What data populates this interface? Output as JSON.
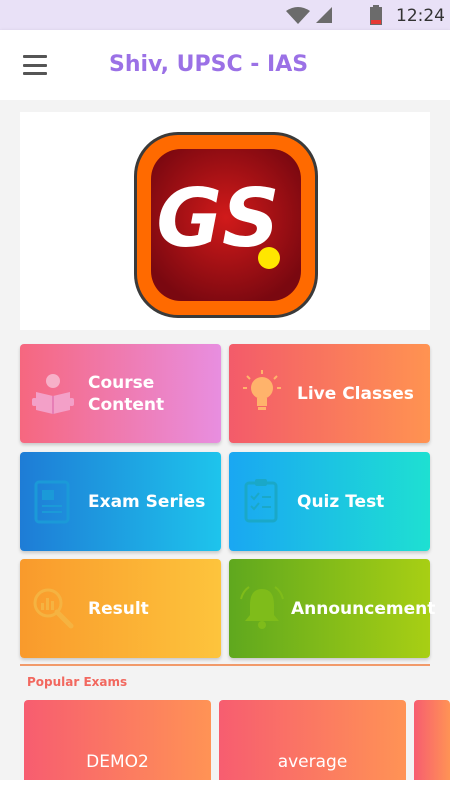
{
  "status_bar": {
    "time": "12:24",
    "icons": [
      "wifi-icon",
      "signal-icon",
      "battery-icon"
    ]
  },
  "app_bar": {
    "title": "Shiv, UPSC - IAS",
    "menu_icon": "hamburger-menu-icon"
  },
  "banner": {
    "logo_text": "GS"
  },
  "tiles": [
    {
      "label": "Course\nContent",
      "icon": "reading-student-icon"
    },
    {
      "label": "Live Classes",
      "icon": "lightbulb-icon"
    },
    {
      "label": "Exam Series",
      "icon": "exam-sheet-icon"
    },
    {
      "label": "Quiz Test",
      "icon": "clipboard-checklist-icon"
    },
    {
      "label": "Result",
      "icon": "magnifier-chart-icon"
    },
    {
      "label": "Announcement",
      "icon": "bell-icon"
    }
  ],
  "popular_exams": {
    "title": "Popular Exams",
    "items": [
      {
        "name": "DEMO2"
      },
      {
        "name": "average"
      },
      {
        "name": ""
      }
    ]
  },
  "colors": {
    "title": "#9b71e6",
    "section_title": "#f2685f",
    "status_bar": "#e9e1f7"
  }
}
